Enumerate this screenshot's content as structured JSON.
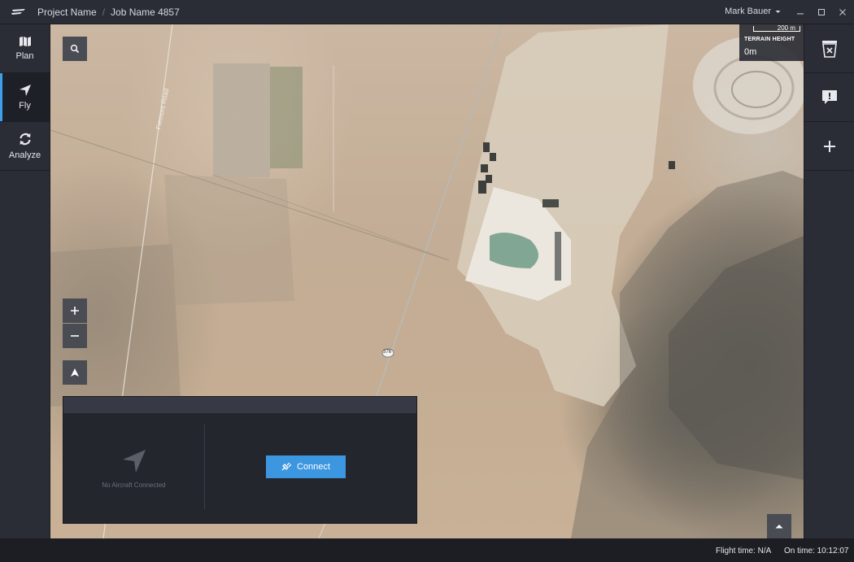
{
  "titlebar": {
    "project_name": "Project Name",
    "separator": "/",
    "job_name": "Job Name 4857",
    "user_name": "Mark Bauer"
  },
  "nav": {
    "items": [
      {
        "label": "Plan",
        "icon": "map-icon",
        "active": false
      },
      {
        "label": "Fly",
        "icon": "navigation-arrow-icon",
        "active": true
      },
      {
        "label": "Analyze",
        "icon": "refresh-cycle-icon",
        "active": false
      }
    ]
  },
  "rail": {
    "items": [
      {
        "icon": "no-flight-zone-icon"
      },
      {
        "icon": "alert-message-icon"
      },
      {
        "icon": "plus-icon"
      }
    ]
  },
  "map": {
    "scale_label": "200 m",
    "terrain_title": "TERRAIN HEIGHT",
    "terrain_value": "0m",
    "road_label": "Fremont Road",
    "route_label": "376"
  },
  "panel": {
    "no_aircraft": "No Aircraft Connected",
    "connect_label": "Connect"
  },
  "status": {
    "flight_time": "Flight time: N/A",
    "on_time": "On time: 10:12:07"
  },
  "colors": {
    "accent": "#3d96e0",
    "active_indicator": "#3ea0ea",
    "chrome": "#2b2d36"
  }
}
